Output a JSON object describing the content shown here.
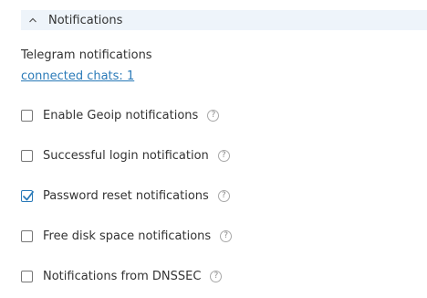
{
  "section": {
    "title": "Notifications",
    "expanded": true
  },
  "telegram": {
    "label": "Telegram notifications",
    "link": "connected chats: 1"
  },
  "options": [
    {
      "label": "Enable Geoip notifications",
      "checked": false,
      "help": "?"
    },
    {
      "label": "Successful login notification",
      "checked": false,
      "help": "?"
    },
    {
      "label": "Password reset notifications",
      "checked": true,
      "help": "?"
    },
    {
      "label": "Free disk space notifications",
      "checked": false,
      "help": "?"
    },
    {
      "label": "Notifications from DNSSEC",
      "checked": false,
      "help": "?"
    }
  ],
  "colors": {
    "header_bg": "#eef4fa",
    "link": "#2a7ab8",
    "check_accent": "#2a7ab8"
  }
}
